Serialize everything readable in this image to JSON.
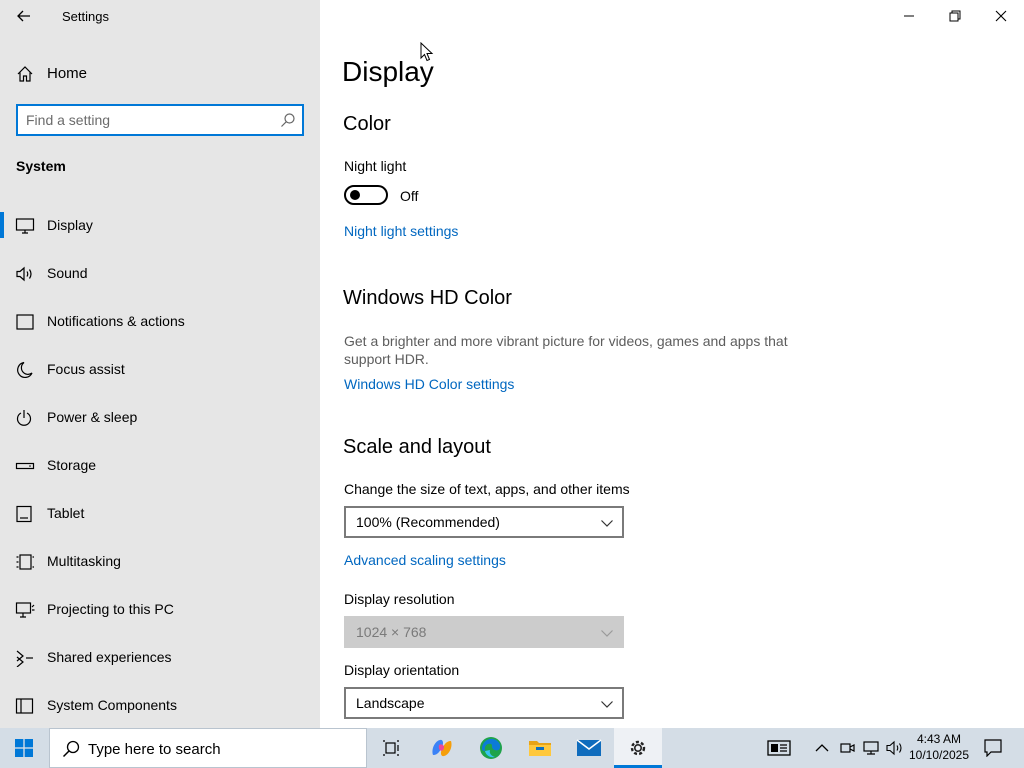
{
  "window": {
    "title": "Settings"
  },
  "sidebar": {
    "home_label": "Home",
    "search_placeholder": "Find a setting",
    "section_label": "System",
    "items": [
      {
        "label": "Display",
        "icon": "monitor-icon",
        "active": true
      },
      {
        "label": "Sound",
        "icon": "speaker-icon"
      },
      {
        "label": "Notifications & actions",
        "icon": "notification-icon"
      },
      {
        "label": "Focus assist",
        "icon": "moon-icon"
      },
      {
        "label": "Power & sleep",
        "icon": "power-icon"
      },
      {
        "label": "Storage",
        "icon": "storage-icon"
      },
      {
        "label": "Tablet",
        "icon": "tablet-icon"
      },
      {
        "label": "Multitasking",
        "icon": "multitasking-icon"
      },
      {
        "label": "Projecting to this PC",
        "icon": "projector-icon"
      },
      {
        "label": "Shared experiences",
        "icon": "share-icon"
      },
      {
        "label": "System Components",
        "icon": "components-icon"
      }
    ]
  },
  "main": {
    "page_title": "Display",
    "color": {
      "heading": "Color",
      "night_light_label": "Night light",
      "night_light_state": "Off",
      "night_light_link": "Night light settings"
    },
    "hdr": {
      "heading": "Windows HD Color",
      "description": "Get a brighter and more vibrant picture for videos, games and apps that support HDR.",
      "link": "Windows HD Color settings"
    },
    "scale": {
      "heading": "Scale and layout",
      "size_label": "Change the size of text, apps, and other items",
      "size_value": "100% (Recommended)",
      "advanced_link": "Advanced scaling settings",
      "resolution_label": "Display resolution",
      "resolution_value": "1024 × 768",
      "orientation_label": "Display orientation",
      "orientation_value": "Landscape"
    }
  },
  "taskbar": {
    "search_text": "Type here to search",
    "clock_time": "4:43 AM",
    "clock_date": "10/10/2025"
  },
  "colors": {
    "accent": "#0078d7",
    "link": "#0067c0",
    "sidebar_bg": "#e6e6e6",
    "taskbar_bg": "#d4dde6"
  }
}
